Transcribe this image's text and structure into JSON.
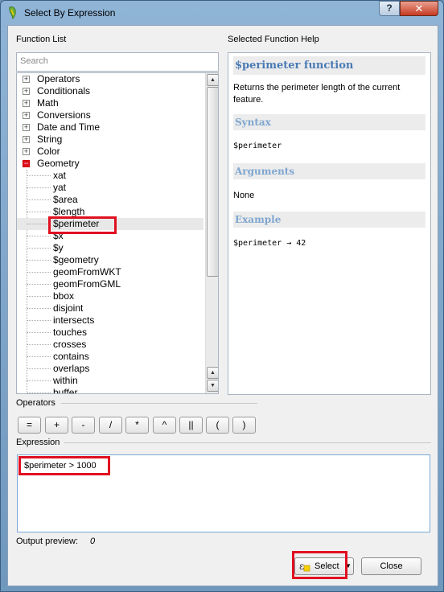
{
  "window": {
    "title": "Select By Expression",
    "help_btn": "?",
    "close_btn": "✕"
  },
  "function_list": {
    "label": "Function List",
    "search_placeholder": "Search",
    "categories_collapsed": [
      "Operators",
      "Conditionals",
      "Math",
      "Conversions",
      "Date and Time",
      "String",
      "Color"
    ],
    "category_open": "Geometry",
    "functions": [
      "xat",
      "yat",
      "$area",
      "$length",
      "$perimeter",
      "$x",
      "$y",
      "$geometry",
      "geomFromWKT",
      "geomFromGML",
      "bbox",
      "disjoint",
      "intersects",
      "touches",
      "crosses",
      "contains",
      "overlaps",
      "within",
      "buffer"
    ],
    "selected_function": "$perimeter"
  },
  "help": {
    "label": "Selected Function Help",
    "title": "$perimeter function",
    "description": "Returns the perimeter length of the current feature.",
    "syntax_h": "Syntax",
    "syntax": "$perimeter",
    "args_h": "Arguments",
    "args": "None",
    "example_h": "Example",
    "example": "$perimeter → 42"
  },
  "operators": {
    "label": "Operators",
    "buttons": [
      "=",
      "+",
      "-",
      "/",
      "*",
      "^",
      "||",
      "(",
      ")"
    ]
  },
  "expression": {
    "label": "Expression",
    "value": "$perimeter > 1000"
  },
  "output_preview": {
    "label": "Output preview:",
    "value": "0"
  },
  "footer": {
    "select_label": "Select",
    "close_label": "Close"
  },
  "colors": {
    "highlight": "#e01020",
    "help_title": "#4a7ab5"
  }
}
